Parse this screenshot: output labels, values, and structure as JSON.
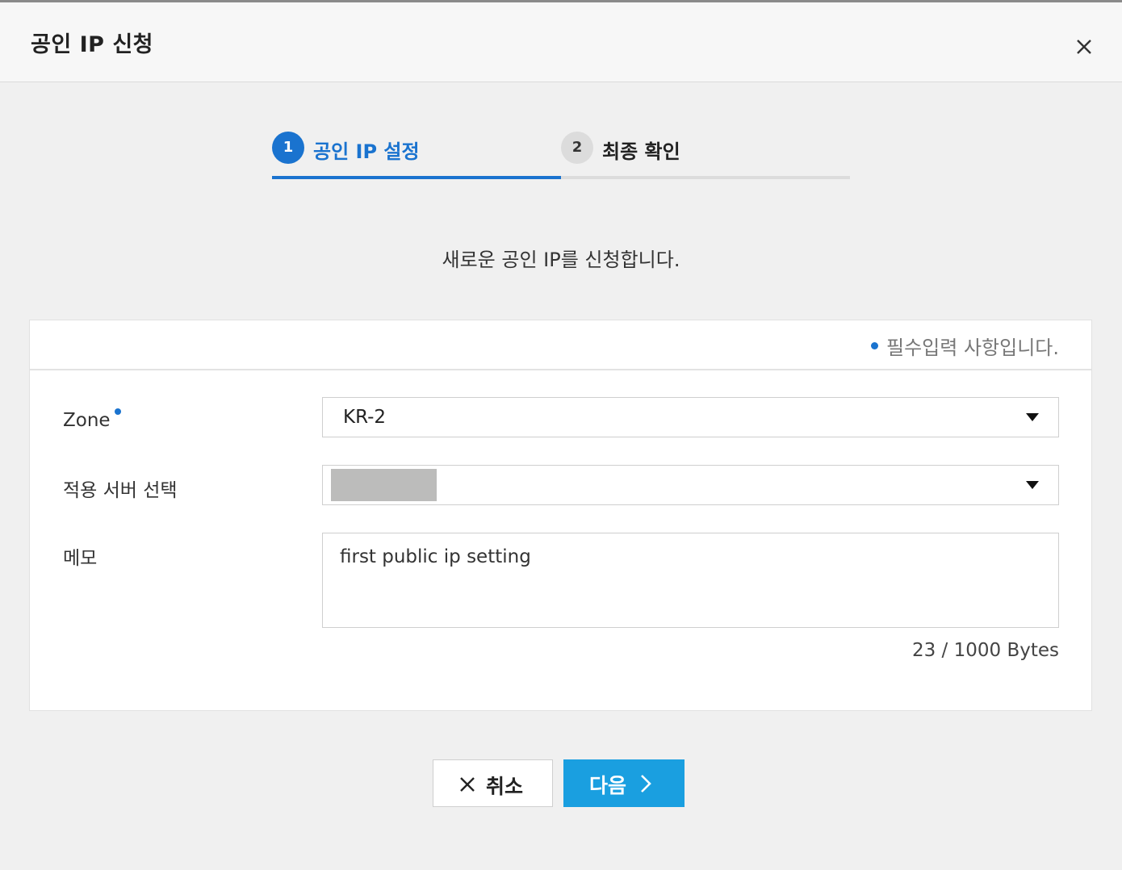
{
  "dialog": {
    "title": "공인 IP 신청",
    "close_icon": "close-icon"
  },
  "steps": [
    {
      "number": "1",
      "label": "공인 IP 설정",
      "active": true
    },
    {
      "number": "2",
      "label": "최종 확인",
      "active": false
    }
  ],
  "subtitle": "새로운 공인 IP를 신청합니다.",
  "form": {
    "required_note": "필수입력 사항입니다.",
    "zone": {
      "label": "Zone",
      "value": "KR-2",
      "required": true
    },
    "server": {
      "label": "적용 서버 선택",
      "value": ""
    },
    "memo": {
      "label": "메모",
      "value": "first public ip setting",
      "counter": "23 / 1000 Bytes"
    }
  },
  "buttons": {
    "cancel": "취소",
    "next": "다음"
  },
  "colors": {
    "accent": "#1a73cf",
    "primary_button": "#1a9fe0",
    "inactive_step": "#dcdcdc"
  }
}
